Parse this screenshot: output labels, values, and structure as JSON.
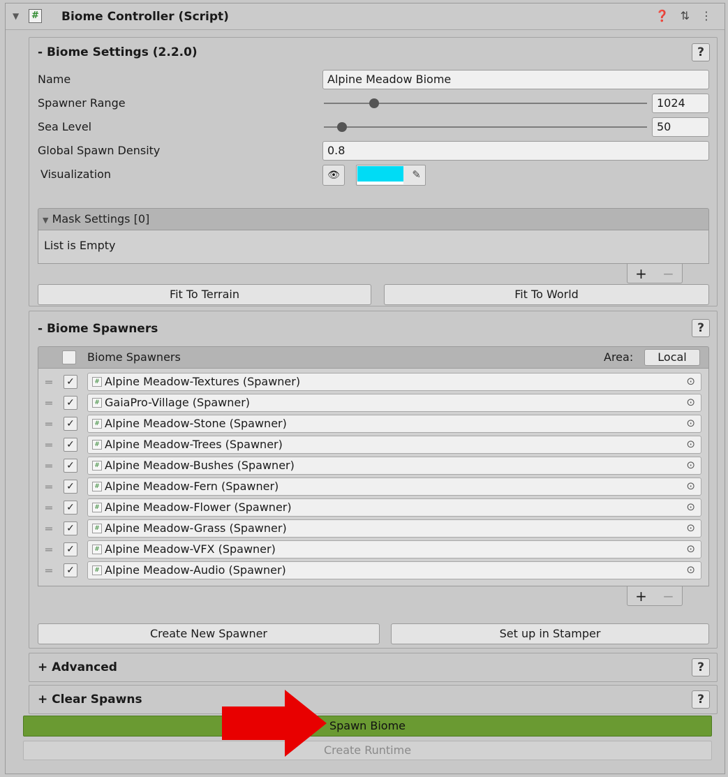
{
  "component": {
    "title": "Biome Controller (Script)",
    "script_glyph": "#"
  },
  "biome_settings": {
    "title": "- Biome Settings  (2.2.0)",
    "help": "?",
    "name_label": "Name",
    "name_value": "Alpine Meadow Biome",
    "spawner_range_label": "Spawner Range",
    "spawner_range_value": "1024",
    "spawner_range_fraction": 0.14,
    "sea_level_label": "Sea Level",
    "sea_level_value": "50",
    "sea_level_fraction": 0.04,
    "density_label": "Global Spawn Density",
    "density_value": "0.8",
    "visualization_label": "Visualization",
    "visualization_color": "#00dcf5",
    "mask_settings_label": "Mask Settings [0]",
    "mask_empty_text": "List is Empty",
    "plus": "+",
    "minus": "−",
    "fit_terrain_label": "Fit To Terrain",
    "fit_world_label": "Fit To World"
  },
  "biome_spawners": {
    "title": "- Biome Spawners",
    "help": "?",
    "list_title": "Biome Spawners",
    "area_label": "Area:",
    "area_value": "Local",
    "check_glyph": "✓",
    "items": [
      {
        "label": "Alpine Meadow-Textures (Spawner)"
      },
      {
        "label": "GaiaPro-Village (Spawner)"
      },
      {
        "label": "Alpine Meadow-Stone (Spawner)"
      },
      {
        "label": "Alpine Meadow-Trees (Spawner)"
      },
      {
        "label": "Alpine Meadow-Bushes (Spawner)"
      },
      {
        "label": "Alpine Meadow-Fern (Spawner)"
      },
      {
        "label": "Alpine Meadow-Flower (Spawner)"
      },
      {
        "label": "Alpine Meadow-Grass (Spawner)"
      },
      {
        "label": "Alpine Meadow-VFX (Spawner)"
      },
      {
        "label": "Alpine Meadow-Audio (Spawner)"
      }
    ],
    "plus": "+",
    "minus": "−",
    "create_new_label": "Create New Spawner",
    "stamper_label": "Set up in Stamper"
  },
  "advanced": {
    "title": "+ Advanced",
    "help": "?"
  },
  "clear_spawns": {
    "title": "+ Clear Spawns",
    "help": "?"
  },
  "spawn_biome_label": "Spawn Biome",
  "create_runtime_label": "Create Runtime",
  "colors": {
    "spawn_button": "#6a9a32",
    "arrow": "#e80000",
    "script_icon": "#2f8a2f"
  }
}
